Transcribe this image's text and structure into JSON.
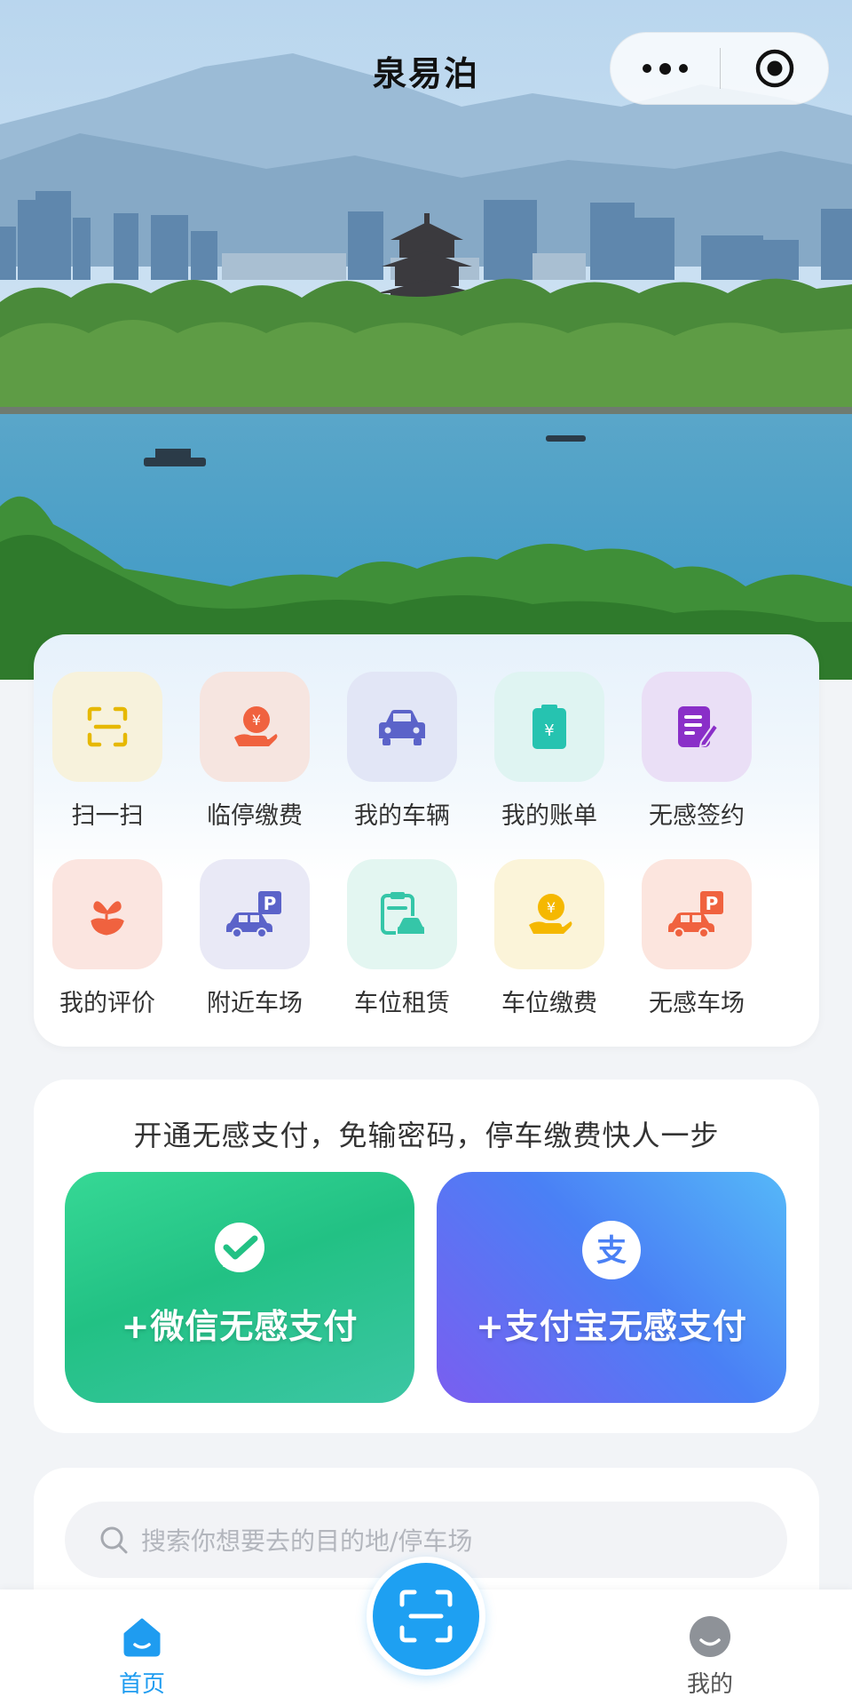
{
  "app": {
    "title": "泉易泊"
  },
  "capsule": {
    "more_icon": "more-dots-icon",
    "close_icon": "target-close-icon"
  },
  "menu": {
    "row1": [
      {
        "label": "扫一扫",
        "icon": "scan-icon"
      },
      {
        "label": "临停缴费",
        "icon": "coin-hand-icon"
      },
      {
        "label": "我的车辆",
        "icon": "car-icon"
      },
      {
        "label": "我的账单",
        "icon": "bill-icon"
      },
      {
        "label": "无感签约",
        "icon": "sign-doc-icon"
      }
    ],
    "row2": [
      {
        "label": "我的评价",
        "icon": "tulip-icon"
      },
      {
        "label": "附近车场",
        "icon": "parking-car-icon"
      },
      {
        "label": "车位租赁",
        "icon": "clipboard-car-icon"
      },
      {
        "label": "车位缴费",
        "icon": "coin-hand-icon"
      },
      {
        "label": "无感车场",
        "icon": "parking-car-icon"
      }
    ]
  },
  "pay": {
    "title": "开通无感支付，免输密码，停车缴费快人一步",
    "wechat_label": "+微信无感支付",
    "alipay_label": "+支付宝无感支付"
  },
  "search": {
    "placeholder": "搜索你想要去的目的地/停车场"
  },
  "tabbar": {
    "home_label": "首页",
    "mine_label": "我的"
  },
  "colors": {
    "accent": "#1ea0f2",
    "wechat": "#22c184",
    "alipay": "#4a80f5"
  }
}
